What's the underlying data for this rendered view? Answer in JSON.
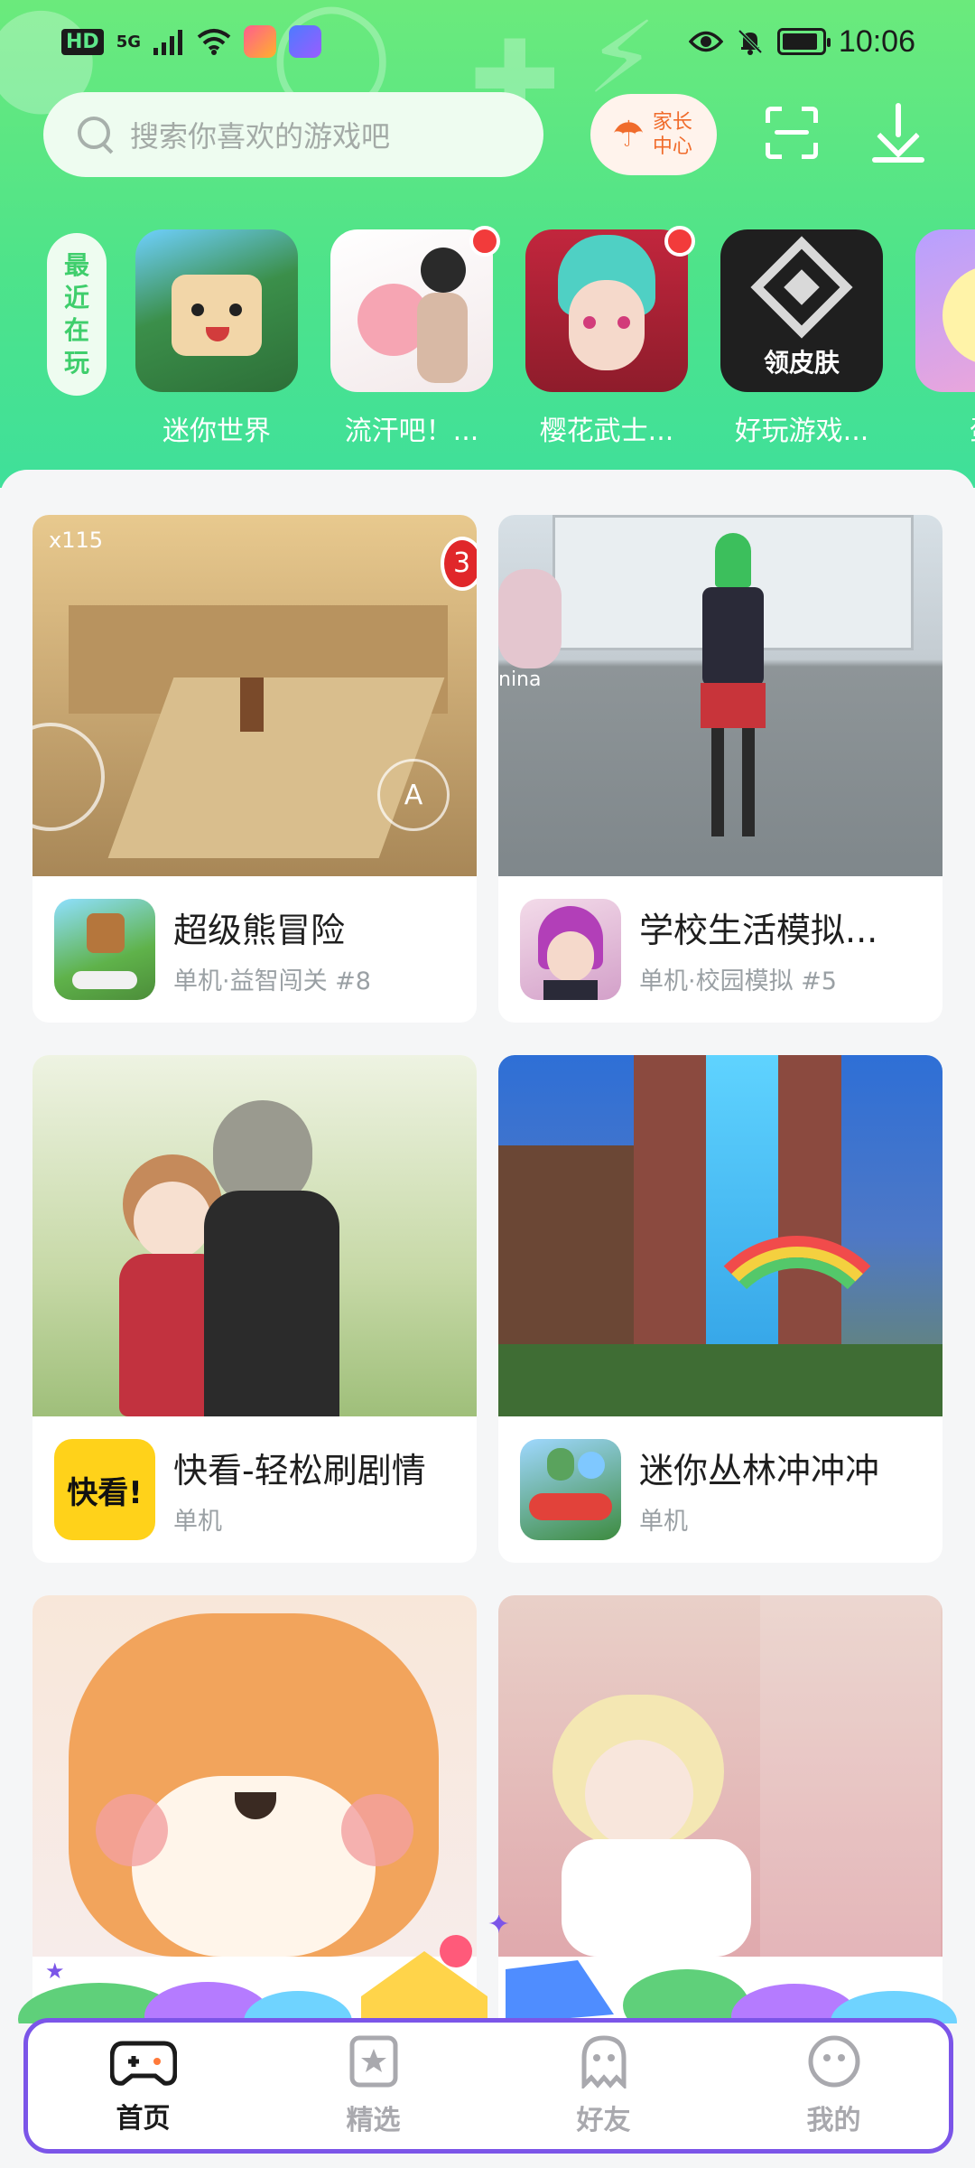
{
  "status_bar": {
    "network_badge": "HD",
    "network_type": "5G",
    "time": "10:06"
  },
  "search": {
    "placeholder": "搜索你喜欢的游戏吧"
  },
  "parent_center": {
    "label": "家长中心"
  },
  "recent": {
    "label_chars": [
      "最",
      "近",
      "在",
      "玩"
    ],
    "games": [
      {
        "name": "迷你世界",
        "has_dot": false,
        "icon_color": "#3b8f4a"
      },
      {
        "name": "流汗吧！...",
        "has_dot": true,
        "icon_color": "#f3e9ea"
      },
      {
        "name": "樱花武士...",
        "has_dot": true,
        "icon_color": "#c2263d"
      },
      {
        "name": "好玩游戏...",
        "has_dot": false,
        "icon_color": "#1f1f1f"
      },
      {
        "name": "蛋仔",
        "has_dot": false,
        "icon_color": "#f3a7d5"
      }
    ]
  },
  "feed": [
    {
      "title": "超级熊冒险",
      "subtitle": "单机·益智闯关 #8",
      "shot_label": "x115",
      "badge": "3",
      "shot_color": "#c9a873",
      "icon_color": "#5fb24a"
    },
    {
      "title": "学校生活模拟...",
      "subtitle": "单机·校园模拟 #5",
      "shot_label": "nina",
      "badge": "",
      "shot_color": "#8e9598",
      "icon_color": "#d3a0c9"
    },
    {
      "title": "快看-轻松刷剧情",
      "subtitle": "单机",
      "shot_label": "",
      "badge": "",
      "shot_color": "#c7d9a7",
      "icon_color": "#ffd21a",
      "icon_text": "快看!"
    },
    {
      "title": "迷你丛林冲冲冲",
      "subtitle": "单机",
      "shot_label": "",
      "badge": "",
      "shot_color": "#4e78c6",
      "icon_color": "#3d8b3f"
    },
    {
      "title": "",
      "subtitle": "",
      "shot_label": "",
      "badge": "",
      "shot_color": "#f2a45c",
      "icon_color": "#fff"
    },
    {
      "title": "",
      "subtitle": "",
      "shot_label": "",
      "badge": "",
      "shot_color": "#e0a9ad",
      "icon_color": "#fff"
    }
  ],
  "nav": {
    "items": [
      {
        "label": "首页",
        "icon": "gamepad-icon",
        "active": true
      },
      {
        "label": "精选",
        "icon": "star-bookmark-icon",
        "active": false
      },
      {
        "label": "好友",
        "icon": "ghost-icon",
        "active": false
      },
      {
        "label": "我的",
        "icon": "smiley-icon",
        "active": false
      }
    ]
  },
  "colors": {
    "header_green": "#4ee38a",
    "accent_orange": "#f06b2b",
    "nav_border_purple": "#7b55e8",
    "active_underline": "#ff7a3a"
  }
}
